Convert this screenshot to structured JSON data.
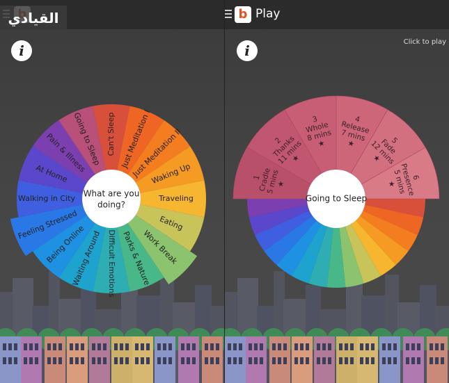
{
  "left_screen": {
    "watermark": "القيادي",
    "info_icon": "info-icon",
    "wheel_center": [
      "What are you",
      "doing?"
    ],
    "categories": [
      {
        "label": "Can't Sleep",
        "color": "#d9503a"
      },
      {
        "label": "Just Meditation I",
        "color": "#ee6524"
      },
      {
        "label": "Just Meditation II",
        "color": "#f47d20"
      },
      {
        "label": "Waking Up",
        "color": "#f59a22"
      },
      {
        "label": "Traveling",
        "color": "#f7b630"
      },
      {
        "label": "Eating",
        "color": "#c9c45a"
      },
      {
        "label": "Work Break",
        "color": "#8bc36e"
      },
      {
        "label": "Parks & Nature",
        "color": "#49b889"
      },
      {
        "label": "Difficult Emotions",
        "color": "#2eaeb2"
      },
      {
        "label": "Waiting Around",
        "color": "#1ea3cf"
      },
      {
        "label": "Being Online",
        "color": "#1e91e2"
      },
      {
        "label": "Feeling Stressed",
        "color": "#2a78e6"
      },
      {
        "label": "Walking in City",
        "color": "#3f5fe0"
      },
      {
        "label": "At Home",
        "color": "#5a47cc"
      },
      {
        "label": "Pain & Illness",
        "color": "#7b3fb0"
      },
      {
        "label": "Going to Sleep",
        "color": "#b8507a"
      }
    ]
  },
  "right_screen": {
    "title": "Play",
    "click_hint": "Click to play",
    "info_icon": "info-icon",
    "wheel_center": "Going to Sleep",
    "sessions": [
      {
        "number": "1",
        "name": "Cradle",
        "duration": "5 mins",
        "star": "★",
        "color": "#b8506a"
      },
      {
        "number": "2",
        "name": "Thanks",
        "duration": "11 mins",
        "star": "★",
        "color": "#c0566f"
      },
      {
        "number": "3",
        "name": "Whole",
        "duration": "8 mins",
        "star": "★",
        "color": "#c75e75"
      },
      {
        "number": "4",
        "name": "Release",
        "duration": "7 mins",
        "star": "★",
        "color": "#cd6679"
      },
      {
        "number": "5",
        "name": "Fade",
        "duration": "12 mins",
        "star": "★",
        "color": "#d2707f"
      },
      {
        "number": "6",
        "name": "Presence",
        "duration": "5 mins",
        "star": "★",
        "color": "#d97b86"
      }
    ],
    "spectrum_colors": [
      "#d9503a",
      "#ee6524",
      "#f47d20",
      "#f59a22",
      "#f7b630",
      "#c9c45a",
      "#8bc36e",
      "#49b889",
      "#2eaeb2",
      "#1ea3cf",
      "#1e91e2",
      "#2a78e6",
      "#3f5fe0",
      "#5a47cc",
      "#7b3fb0"
    ]
  },
  "city": {
    "bg_colors": [
      "#525560",
      "#585b66",
      "#4f5260"
    ],
    "house_colors": [
      "#8a96c8",
      "#b07ab0",
      "#c98a7a",
      "#d99c7c",
      "#b07a98",
      "#cdb06a",
      "#d6b872"
    ],
    "tree_color": "#3f8a56"
  }
}
